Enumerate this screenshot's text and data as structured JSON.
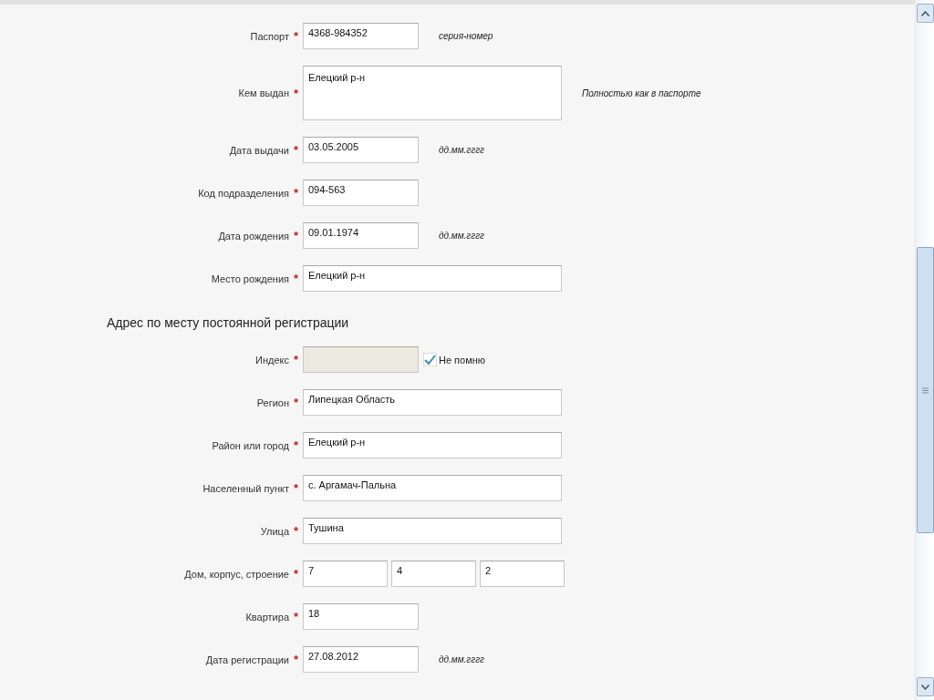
{
  "sections": [
    {
      "fields": [
        {
          "label": "Паспорт",
          "mark": "*",
          "kind": "short",
          "value": "4368-984352",
          "hint": "серия-номер"
        },
        {
          "label": "Кем выдан",
          "mark": "*",
          "kind": "textarea",
          "value": "Елецкий р-н",
          "hint": "Полностью как в паспорте"
        },
        {
          "label": "Дата выдачи",
          "mark": "*",
          "kind": "short",
          "value": "03.05.2005",
          "hint": "дд.мм.гггг"
        },
        {
          "label": "Код подразделения",
          "mark": "*",
          "kind": "short",
          "value": "094-563"
        },
        {
          "label": "Дата рождения",
          "mark": "*",
          "kind": "short",
          "value": "09.01.1974",
          "hint": "дд.мм.гггг"
        },
        {
          "label": "Место рождения",
          "mark": "*",
          "kind": "long",
          "value": "Елецкий р-н"
        }
      ]
    },
    {
      "heading": "Адрес по месту постоянной регистрации",
      "fields": [
        {
          "label": "Индекс",
          "mark": "*",
          "kind": "short",
          "disabled": true,
          "checkbox": {
            "label": "Не помню",
            "checked": true
          }
        },
        {
          "label": "Регион",
          "mark": "*",
          "kind": "long",
          "value": "Липецкая Область"
        },
        {
          "label": "Район или город",
          "mark": "*",
          "kind": "long",
          "value": "Елецкий р-н"
        },
        {
          "label": "Населенный пункт",
          "mark": "*",
          "kind": "long",
          "value": "с. Аргамач-Пальна"
        },
        {
          "label": "Улица",
          "mark": "*",
          "kind": "long",
          "value": "Тушина"
        },
        {
          "label": "Дом, корпус, строение",
          "mark": "*",
          "kind": "triple",
          "values": [
            "7",
            "4",
            "2"
          ]
        },
        {
          "label": "Квартира",
          "mark": "*",
          "kind": "short",
          "value": "18"
        },
        {
          "label": "Дата регистрации",
          "mark": "*",
          "kind": "short",
          "value": "27.08.2012",
          "hint": "дд.мм.гггг"
        }
      ]
    }
  ]
}
